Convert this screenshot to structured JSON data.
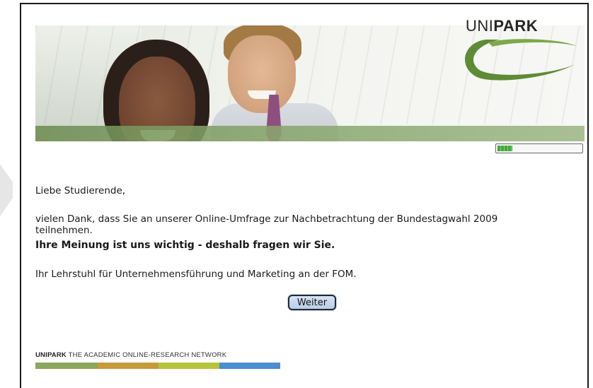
{
  "banner": {
    "logo": {
      "prefix": "UNI",
      "suffix": "PARK"
    }
  },
  "progress": {
    "percent": 18
  },
  "content": {
    "greeting": "Liebe Studierende,",
    "intro_line1": "vielen Dank, dass Sie an unserer Online-Umfrage zur Nachbetrachtung der Bundestagwahl 2009",
    "intro_line2": "teilnehmen.",
    "emphasis": "Ihre Meinung ist uns wichtig - deshalb fragen wir Sie.",
    "signature": "Ihr Lehrstuhl für Unternehmensführung und Marketing an der FOM."
  },
  "buttons": {
    "next_label": "Weiter"
  },
  "footer": {
    "brand": "UNIPARK",
    "tagline": "THE ACADEMIC ONLINE-RESEARCH NETWORK",
    "bar_colors": [
      "#8aa85d",
      "#c69a3a",
      "#b6c43c",
      "#4a8fd0"
    ]
  },
  "colors": {
    "accent_green": "#3faa36",
    "button_bg": "#c8d9ee",
    "banner_green": "#87a46b"
  }
}
